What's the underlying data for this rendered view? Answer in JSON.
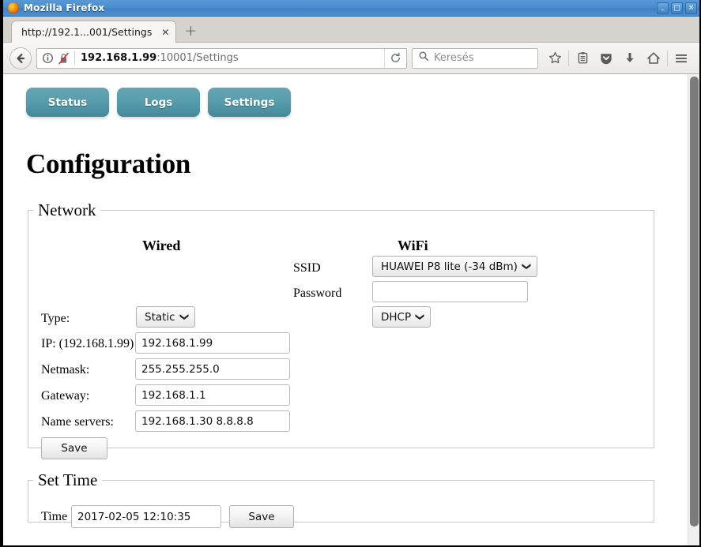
{
  "window": {
    "title": "Mozilla Firefox",
    "logo_icon": "firefox-logo-icon",
    "buttons": {
      "minimize": "–",
      "maximize": "□",
      "close": "✕"
    }
  },
  "browser": {
    "tab": {
      "label": "http://192.1...001/Settings",
      "close": "✕"
    },
    "new_tab": "+",
    "back_icon": "back-arrow-icon",
    "urlbar": {
      "info_icon": "page-info-icon",
      "security_icon": "insecure-connection-icon",
      "host": "192.168.1.99",
      "path": ":10001/Settings",
      "reload_icon": "reload-icon"
    },
    "search": {
      "icon": "search-icon",
      "placeholder": "Keresés"
    },
    "toolbar_icons": [
      {
        "name": "bookmark-star-icon",
        "label": "☆"
      },
      {
        "name": "library-icon",
        "label": "▤"
      },
      {
        "name": "pocket-icon",
        "label": "▼"
      },
      {
        "name": "downloads-icon",
        "label": "↓"
      },
      {
        "name": "home-icon",
        "label": "⌂"
      },
      {
        "name": "menu-hamburger-icon",
        "label": "☰"
      }
    ]
  },
  "page": {
    "nav_buttons": [
      {
        "label": "Status"
      },
      {
        "label": "Logs"
      },
      {
        "label": "Settings"
      }
    ],
    "title": "Configuration",
    "network": {
      "legend": "Network",
      "col_wired": "Wired",
      "col_wifi": "WiFi",
      "ssid_label": "SSID",
      "ssid_value": "HUAWEI P8 lite (-34 dBm)",
      "password_label": "Password",
      "password_value": "",
      "type_label": "Type:",
      "wired_type_value": "Static",
      "wifi_type_value": "DHCP",
      "ip_label": "IP: (192.168.1.99)",
      "ip_value": "192.168.1.99",
      "netmask_label": "Netmask:",
      "netmask_value": "255.255.255.0",
      "gateway_label": "Gateway:",
      "gateway_value": "192.168.1.1",
      "nameservers_label": "Name servers:",
      "nameservers_value": "192.168.1.30 8.8.8.8",
      "save_label": "Save"
    },
    "set_time": {
      "legend": "Set Time",
      "time_label": "Time",
      "time_value": "2017-02-05 12:10:35",
      "save_label": "Save"
    }
  },
  "colors": {
    "nav_button_teal": "#5397a6",
    "titlebar_blue": "#4a8ccb",
    "fieldset_border": "#c8c8c8"
  }
}
